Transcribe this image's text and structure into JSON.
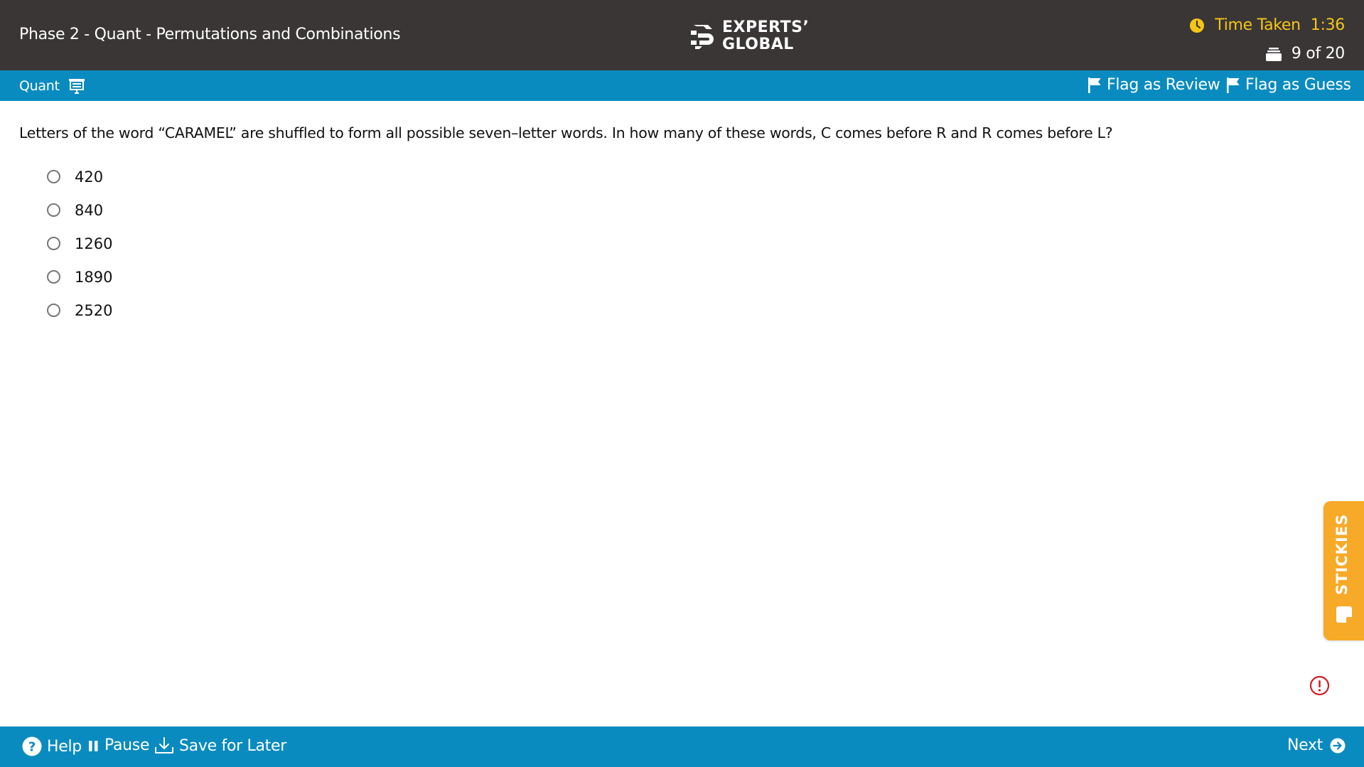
{
  "header": {
    "title": "Phase 2 - Quant - Permutations and Combinations",
    "logo_line1": "EXPERTS’",
    "logo_line2": "GLOBAL",
    "timer_label": "Time Taken",
    "timer_value": "1:36",
    "progress": "9 of 20"
  },
  "toolbar": {
    "section": "Quant",
    "flag_review": "Flag as Review",
    "flag_guess": "Flag as Guess"
  },
  "question": {
    "text": "Letters of the word “CARAMEL” are shuffled to form all possible seven–letter words. In how many of these words, C comes before R and R comes before L?",
    "options": [
      "420",
      "840",
      "1260",
      "1890",
      "2520"
    ],
    "selected": null
  },
  "stickies": {
    "label": "STICKIES"
  },
  "footer": {
    "help": "Help",
    "pause": "Pause",
    "save": "Save for Later",
    "next": "Next"
  },
  "colors": {
    "header_bg": "#3a3636",
    "toolbar_bg": "#0a8bc0",
    "timer": "#f5c518",
    "stickies": "#f7a928",
    "alert": "#d21f26"
  },
  "icons": [
    "logo-icon",
    "clock-icon",
    "question-stack-icon",
    "presentation-icon",
    "flag-icon",
    "sticky-note-icon",
    "alert-icon",
    "help-icon",
    "pause-icon",
    "download-icon",
    "next-arrow-icon"
  ]
}
